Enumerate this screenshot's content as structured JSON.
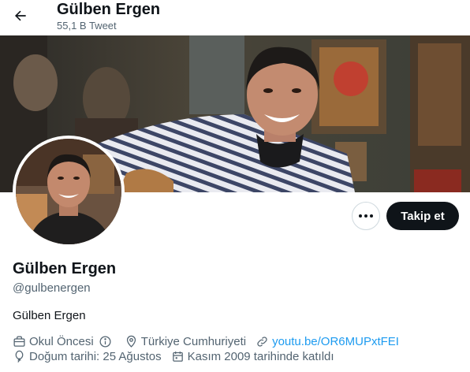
{
  "header": {
    "name": "Gülben Ergen",
    "tweet_count": "55,1 B Tweet"
  },
  "profile": {
    "name": "Gülben Ergen",
    "handle": "@gulbenergen",
    "bio": "Gülben Ergen",
    "category": "Okul Öncesi",
    "location": "Türkiye Cumhuriyeti",
    "website": "youtu.be/OR6MUPxtFEI",
    "birthday": "Doğum tarihi: 25 Ağustos",
    "joined": "Kasım 2009 tarihinde katıldı"
  },
  "actions": {
    "follow_label": "Takip et"
  },
  "colors": {
    "accent": "#1d9bf0",
    "primary_button": "#0f1419",
    "secondary_text": "#536471"
  },
  "icons": {
    "back": "arrow-left-icon",
    "more": "more-horizontal-icon",
    "category": "briefcase-icon",
    "info": "info-circle-icon",
    "location": "location-pin-icon",
    "website": "link-icon",
    "birthday": "balloon-icon",
    "joined": "calendar-icon"
  }
}
